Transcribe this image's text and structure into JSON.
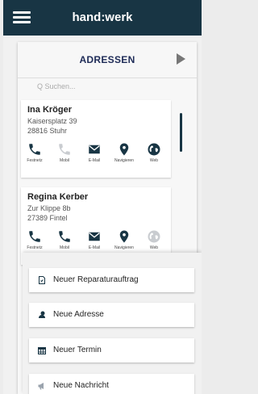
{
  "app": {
    "title": "hand:werk"
  },
  "panel": {
    "title": "ADRESSEN"
  },
  "search": {
    "placeholder": "Q Suchen..."
  },
  "contacts": [
    {
      "name": "Ina Kröger",
      "street": "Kaisersplatz 39",
      "city": "28816 Stuhr",
      "actions": [
        {
          "icon": "phone-icon",
          "label": "Festnetz",
          "enabled": true
        },
        {
          "icon": "mobile-phone-icon",
          "label": "Mobil",
          "enabled": false
        },
        {
          "icon": "email-icon",
          "label": "E-Mail",
          "enabled": true
        },
        {
          "icon": "location-pin-icon",
          "label": "Navigieren",
          "enabled": true
        },
        {
          "icon": "globe-icon",
          "label": "Web",
          "enabled": true
        }
      ]
    },
    {
      "name": "Regina Kerber",
      "street": "Zur Klippe 8b",
      "city": "27389 Fintel",
      "actions": [
        {
          "icon": "phone-icon",
          "label": "Festnetz",
          "enabled": true
        },
        {
          "icon": "mobile-phone-icon",
          "label": "Mobil",
          "enabled": true
        },
        {
          "icon": "email-icon",
          "label": "E-Mail",
          "enabled": true
        },
        {
          "icon": "location-pin-icon",
          "label": "Navigieren",
          "enabled": true
        },
        {
          "icon": "globe-icon",
          "label": "Web",
          "enabled": false
        }
      ]
    }
  ],
  "sheet": {
    "items": [
      {
        "label": "Neuer Reparaturauftrag",
        "icon": "repair-order-icon"
      },
      {
        "label": "Neue Adresse",
        "icon": "address-icon"
      },
      {
        "label": "Neuer Termin",
        "icon": "calendar-icon"
      },
      {
        "label": "Neue Nachricht",
        "icon": "megaphone-icon"
      }
    ]
  },
  "colors": {
    "topbar": "#183544",
    "icon": "#183544",
    "disabled_icon": "#c9ccd0",
    "panel_title": "#1e2b57"
  }
}
